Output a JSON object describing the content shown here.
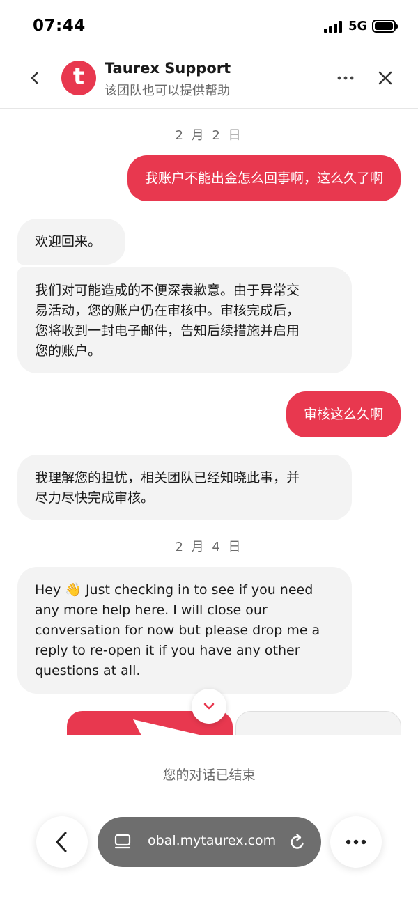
{
  "status_bar": {
    "time": "07:44",
    "network": "5G"
  },
  "header": {
    "avatar_letter": "t",
    "title": "Taurex Support",
    "subtitle": "该团队也可以提供帮助"
  },
  "chat": {
    "date_1": "2 月 2 日",
    "msg_out_1": "我账户不能出金怎么回事啊，这么久了啊",
    "msg_in_1": "欢迎回来。",
    "msg_in_2_lines": [
      "我们对可能造成的不便深表歉意。由于异常交",
      "易活动，您的账户仍在审核中。审核完成后，",
      "您将收到一封电子邮件，告知后续措施并启用",
      "您的账户。"
    ],
    "msg_out_2": "审核这么久啊",
    "msg_in_3_lines": [
      "我理解您的担忧，相关团队已经知晓此事，并",
      "尽力尽快完成审核。"
    ],
    "date_2": "2 月 4 日",
    "msg_in_4_lines": [
      "Hey 👋 Just checking in to see if you need",
      "any more help here. I will close our",
      "conversation for now but please drop me a",
      "reply to re-open it if you have any other",
      "questions at all."
    ]
  },
  "footer": {
    "ended_text": "您的对话已结束"
  },
  "browser": {
    "url": "obal.mytaurex.com"
  },
  "colors": {
    "accent": "#e8384f",
    "bubble_in": "#f3f3f3",
    "muted_text": "#6b6b6b"
  },
  "icons": {
    "back": "chevron-left-icon",
    "more": "ellipsis-icon",
    "close": "close-icon",
    "scroll": "chevron-down-icon",
    "tabs": "tabs-icon",
    "reload": "reload-icon"
  }
}
